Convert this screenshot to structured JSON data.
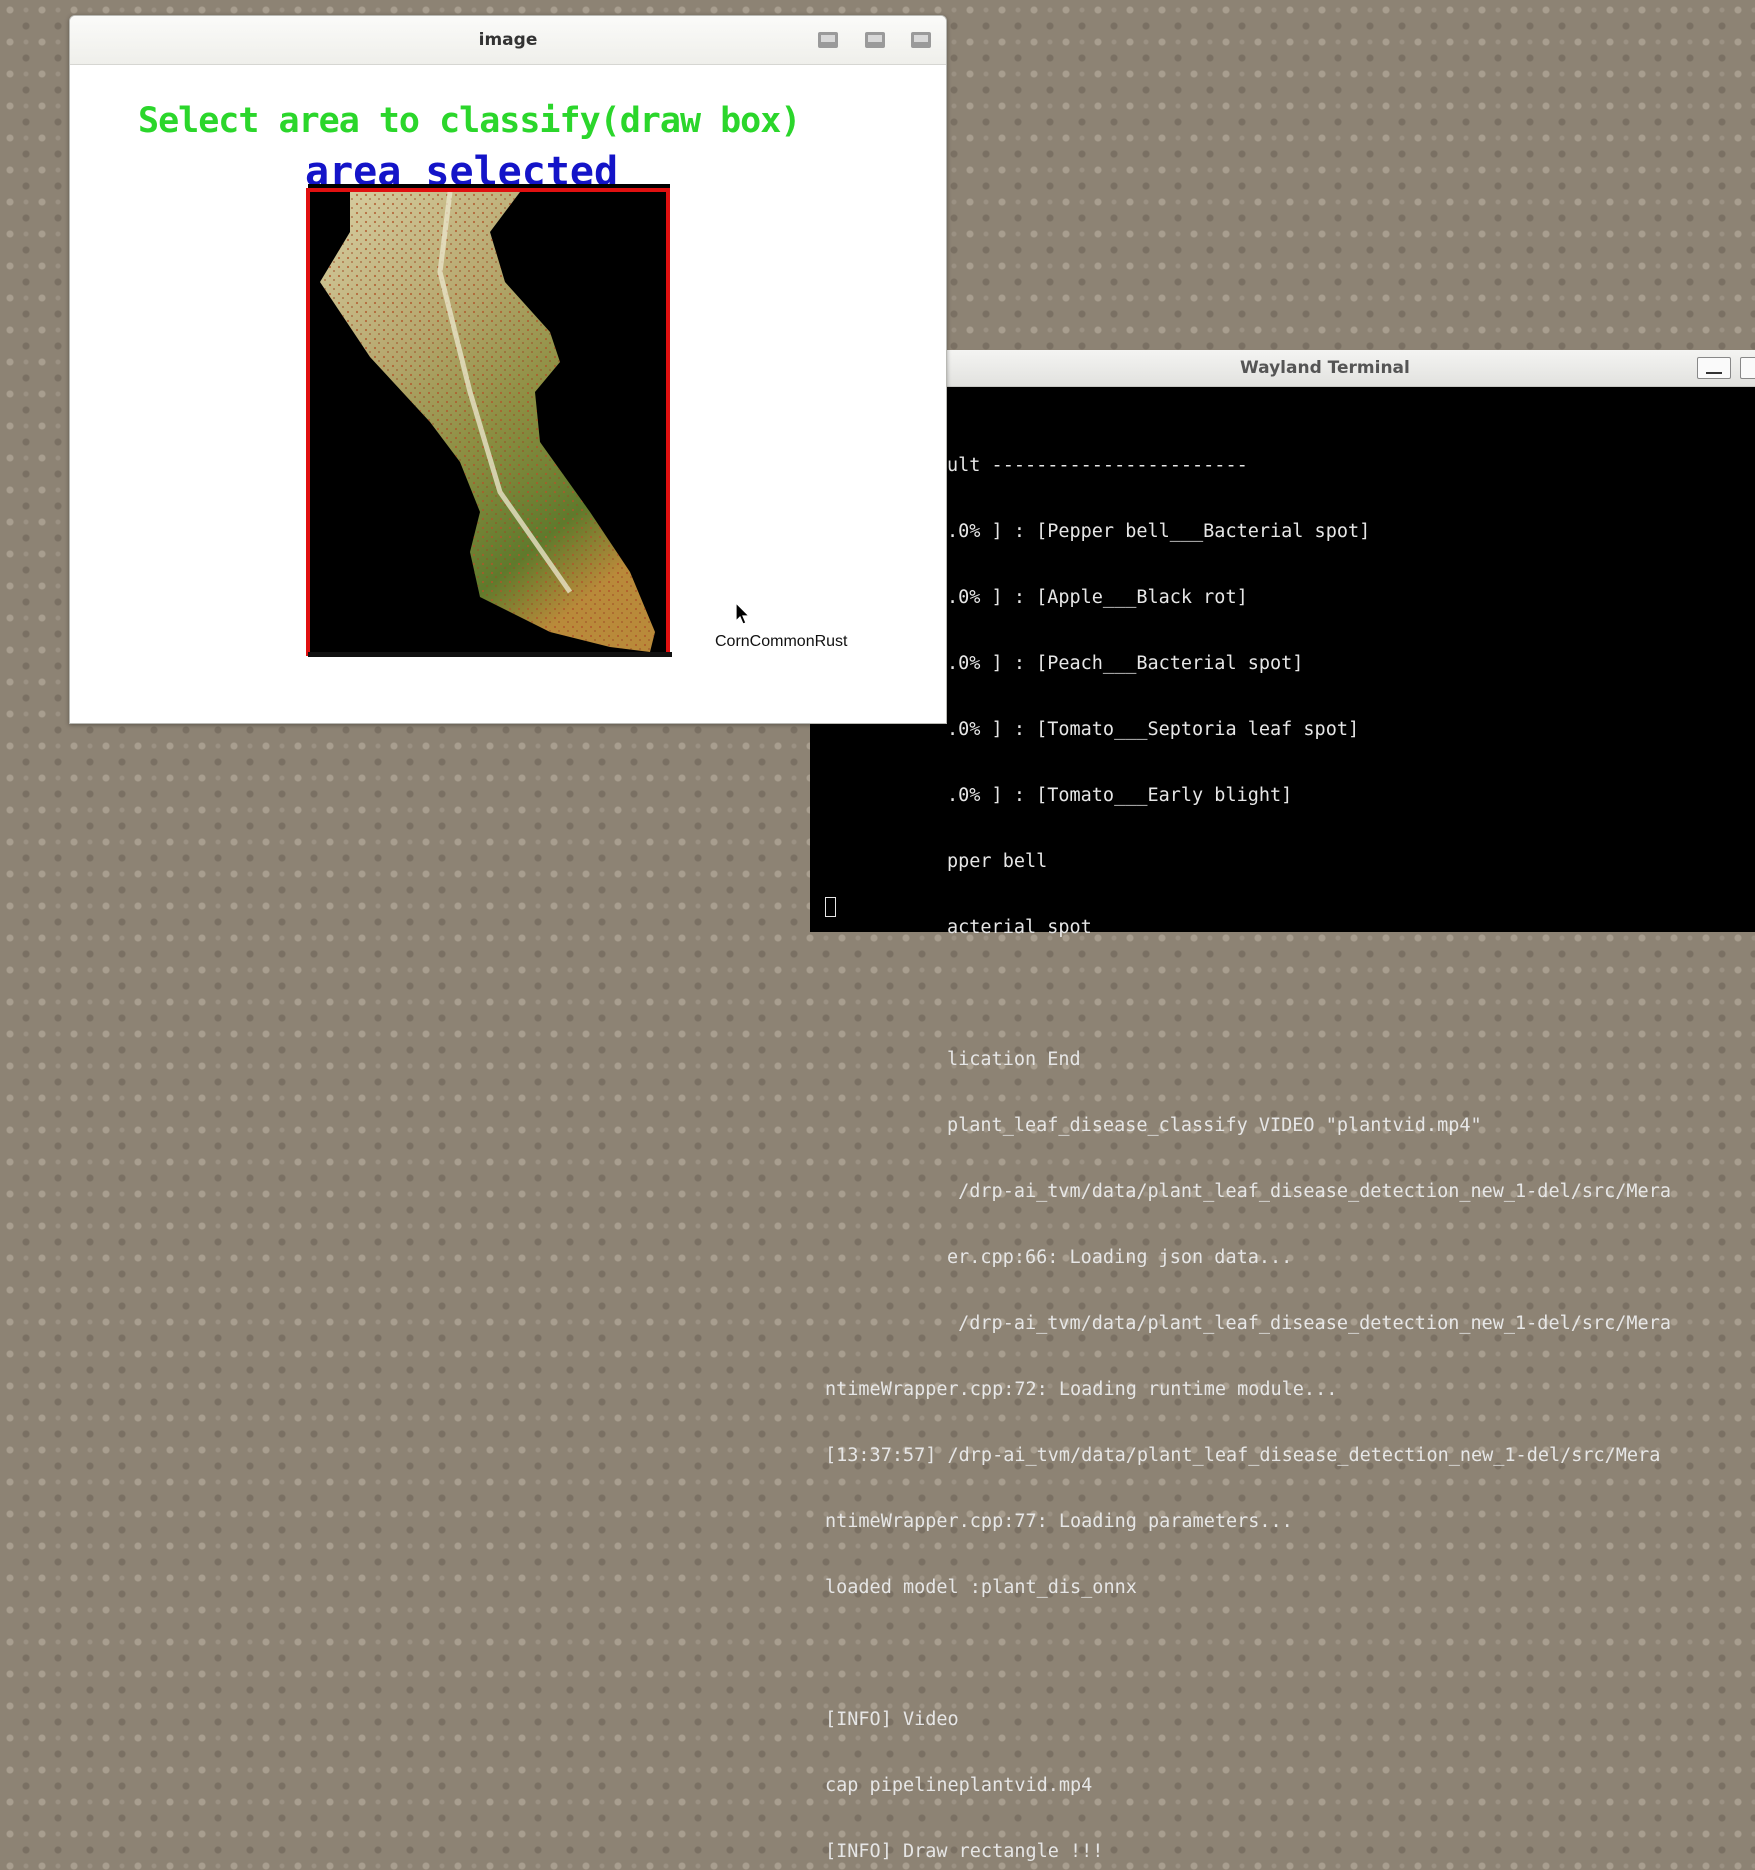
{
  "terminal": {
    "title": "Wayland Terminal",
    "lines": [
      "ult -----------------------",
      ".0% ] : [Pepper bell___Bacterial spot]",
      ".0% ] : [Apple___Black rot]",
      ".0% ] : [Peach___Bacterial spot]",
      ".0% ] : [Tomato___Septoria leaf spot]",
      ".0% ] : [Tomato___Early blight]",
      "pper bell",
      "acterial spot",
      "",
      "lication End",
      "plant_leaf_disease_classify VIDEO \"plantvid.mp4\"",
      " /drp-ai_tvm/data/plant_leaf_disease_detection_new_1-del/src/Mera",
      "er.cpp:66: Loading json data...",
      " /drp-ai_tvm/data/plant_leaf_disease_detection_new_1-del/src/Mera",
      "ntimeWrapper.cpp:72: Loading runtime module...",
      "[13:37:57] /drp-ai_tvm/data/plant_leaf_disease_detection_new_1-del/src/Mera",
      "ntimeWrapper.cpp:77: Loading parameters...",
      "loaded model :plant_dis_onnx",
      "",
      "[INFO] Video",
      "cap pipelineplantvid.mp4",
      "[INFO] Draw rectangle !!!"
    ]
  },
  "image_window": {
    "title": "image",
    "instruction": "Select area to classify(draw box)",
    "selection_label": "area selected",
    "result_label": "CornCommonRust"
  },
  "colors": {
    "instruction": "#2bd62b",
    "selection_label": "#1414c8",
    "selection_box": "#e01010"
  }
}
